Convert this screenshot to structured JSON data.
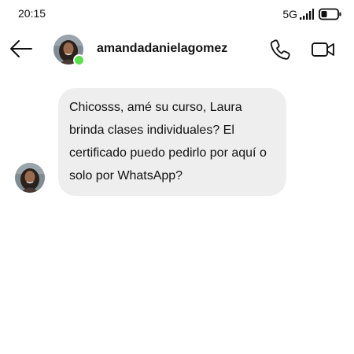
{
  "status_bar": {
    "time": "20:15",
    "network": "5G",
    "icons": [
      "signal-icon",
      "battery-icon"
    ]
  },
  "header": {
    "username": "amandadanielagomez",
    "online": true,
    "icons": [
      "back-arrow-icon",
      "phone-icon",
      "video-camera-icon"
    ]
  },
  "messages": [
    {
      "sender": "amandadanielagomez",
      "direction": "incoming",
      "text": "Chicosss, amé su curso, Laura brinda clases individuales? El certificado puedo pedirlo por aquí o solo por WhatsApp?"
    }
  ],
  "colors": {
    "bubble_background": "#eeeeef",
    "online_indicator": "#5be04c",
    "text": "#111111",
    "background": "#ffffff"
  }
}
